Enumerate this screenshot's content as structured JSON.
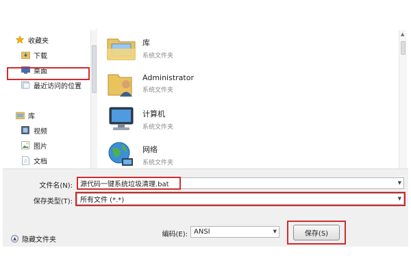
{
  "nav": {
    "items": [
      {
        "label": "收藏夹",
        "icon": "star-icon"
      },
      {
        "label": "下载",
        "icon": "download-folder-icon"
      },
      {
        "label": "桌面",
        "icon": "desktop-icon"
      },
      {
        "label": "最近访问的位置",
        "icon": "recent-places-icon"
      },
      {
        "label": "库",
        "icon": "library-icon"
      },
      {
        "label": "视频",
        "icon": "video-icon"
      },
      {
        "label": "图片",
        "icon": "picture-icon"
      },
      {
        "label": "文档",
        "icon": "document-icon"
      }
    ]
  },
  "files": [
    {
      "name": "库",
      "type": "系统文件夹",
      "icon": "library-folder-icon"
    },
    {
      "name": "Administrator",
      "type": "系统文件夹",
      "icon": "user-folder-icon"
    },
    {
      "name": "计算机",
      "type": "系统文件夹",
      "icon": "computer-icon"
    },
    {
      "name": "网络",
      "type": "系统文件夹",
      "icon": "network-globe-icon"
    }
  ],
  "form": {
    "filename_label": "文件名(N):",
    "filename_value": "源代码一键系统垃圾清理.bat",
    "filetype_label": "保存类型(T):",
    "filetype_value": "所有文件  (*.*)",
    "encoding_label": "编码(E):",
    "encoding_value": "ANSI",
    "save_label": "保存(S)",
    "hide_folders_label": "隐藏文件夹"
  },
  "colors": {
    "highlight": "#d02b2b"
  }
}
